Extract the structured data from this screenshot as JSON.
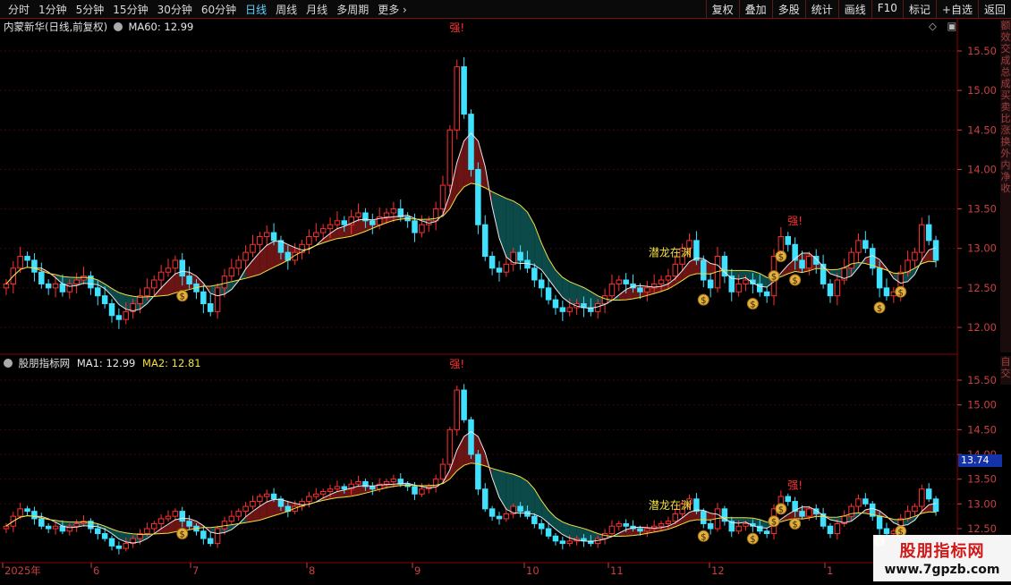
{
  "toolbar": {
    "periods": [
      "分时",
      "1分钟",
      "5分钟",
      "15分钟",
      "30分钟",
      "60分钟",
      "日线",
      "周线",
      "月线",
      "多周期",
      "更多"
    ],
    "active_period": "日线",
    "actions": [
      "复权",
      "叠加",
      "多股",
      "统计",
      "画线",
      "F10",
      "标记",
      "+自选",
      "返回"
    ]
  },
  "main_panel": {
    "title": "内蒙新华(日线,前复权)",
    "ma_label": "MA60: 12.99",
    "ma_color": "#e8e8e8"
  },
  "sub_panel": {
    "title": "股朋指标网",
    "ma1_label": "MA1: 12.99",
    "ma2_label": "MA2: 12.81",
    "ma1_color": "#e8e8e8",
    "ma2_color": "#f0e040",
    "price_tag": "13.74"
  },
  "annotations": {
    "strong": "强!",
    "dragon": "潜龙在渊",
    "coin": "$"
  },
  "right_strip": {
    "main": [
      "额",
      "效",
      "交",
      "成",
      "总",
      "成",
      "买",
      "卖",
      "比",
      "涨",
      "换",
      "外",
      "内",
      "净",
      "收"
    ],
    "sub": [
      "自",
      "交"
    ]
  },
  "watermark": {
    "title": "股朋指标网",
    "url": "www.7gpzb.com"
  },
  "colors": {
    "up": "#ff3030",
    "down": "#40e0ff",
    "ma_fast": "#e8e8e8",
    "ma_slow": "#f0e040",
    "fill_up": "#6a1414",
    "fill_down": "#0c4a4a",
    "axis": "#8b0000",
    "grid": "#3a0a0a",
    "tick": "#c84040"
  },
  "chart_data": {
    "type": "candlestick",
    "title": "内蒙新华(日线,前复权)",
    "x_labels": [
      "2025年",
      "6",
      "7",
      "8",
      "9",
      "10",
      "11",
      "12",
      "1"
    ],
    "main_y_ticks": [
      12.0,
      12.5,
      13.0,
      13.5,
      14.0,
      14.5,
      15.0,
      15.5
    ],
    "sub_y_ticks": [
      12.5,
      13.0,
      13.5,
      14.0,
      14.5,
      15.0,
      15.5
    ],
    "ylim": [
      11.9,
      15.8
    ],
    "close": [
      12.55,
      12.75,
      12.9,
      12.85,
      12.7,
      12.55,
      12.5,
      12.55,
      12.45,
      12.55,
      12.6,
      12.65,
      12.5,
      12.4,
      12.3,
      12.15,
      12.1,
      12.2,
      12.3,
      12.4,
      12.5,
      12.6,
      12.7,
      12.75,
      12.85,
      12.65,
      12.55,
      12.45,
      12.3,
      12.2,
      12.5,
      12.65,
      12.75,
      12.85,
      12.95,
      13.05,
      13.15,
      13.2,
      13.1,
      12.95,
      12.85,
      12.95,
      13.05,
      13.15,
      13.2,
      13.25,
      13.3,
      13.35,
      13.3,
      13.4,
      13.45,
      13.35,
      13.3,
      13.4,
      13.45,
      13.5,
      13.4,
      13.35,
      13.2,
      13.3,
      13.35,
      13.5,
      13.8,
      14.5,
      15.3,
      14.7,
      14.0,
      13.3,
      12.9,
      12.75,
      12.7,
      12.8,
      12.95,
      12.85,
      12.75,
      12.6,
      12.5,
      12.35,
      12.25,
      12.2,
      12.25,
      12.3,
      12.25,
      12.2,
      12.3,
      12.4,
      12.55,
      12.6,
      12.55,
      12.5,
      12.45,
      12.5,
      12.55,
      12.6,
      12.65,
      12.8,
      13.0,
      13.1,
      12.85,
      12.6,
      12.5,
      12.9,
      12.65,
      12.45,
      12.55,
      12.6,
      12.55,
      12.45,
      12.4,
      12.9,
      13.15,
      13.05,
      12.85,
      12.75,
      12.9,
      12.8,
      12.55,
      12.4,
      12.6,
      12.75,
      12.95,
      13.1,
      13.0,
      12.75,
      12.5,
      12.4,
      12.45,
      12.7,
      12.85,
      12.95,
      13.3,
      13.1,
      12.85
    ],
    "strong_marks_at": [
      64,
      112
    ],
    "dragon_mark_at": 94,
    "coin_marks_at": [
      25,
      99,
      106,
      109,
      110,
      112,
      124,
      127
    ]
  }
}
